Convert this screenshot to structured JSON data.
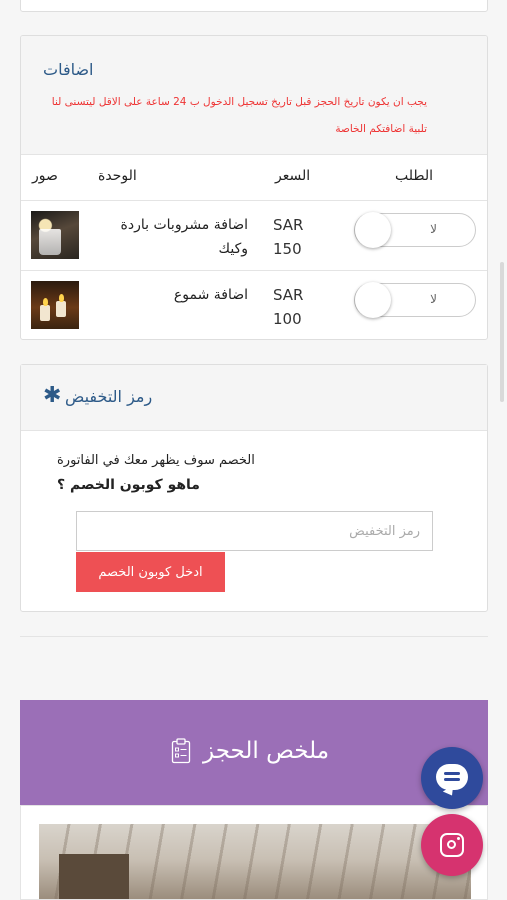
{
  "extras": {
    "title": "اضافات",
    "note": "يجب ان يكون تاريخ الحجز قبل تاريخ تسجيل الدخول ب 24 ساعة على الاقل ليتسنى لنا تلبية اضافتكم الخاصة",
    "columns": {
      "photos": "صور",
      "unit": "الوحدة",
      "price": "السعر",
      "order": "الطلب"
    },
    "items": [
      {
        "name": "اضافة مشروبات باردة وكيك",
        "currency": "SAR",
        "price": "150",
        "toggle_label": "لا"
      },
      {
        "name": "اضافة شموع",
        "currency": "SAR",
        "price": "100",
        "toggle_label": "لا"
      }
    ]
  },
  "discount": {
    "title": "رمز التخفيض",
    "description": "الخصم سوف يظهر معك في الفاتورة",
    "question": "ماهو كوبون الخصم ؟",
    "input_placeholder": "رمز التخفيض",
    "button_label": "ادخل كوبون الخصم"
  },
  "summary": {
    "title": "ملخص الحجز"
  },
  "colors": {
    "accent_purple": "#9b6fb7",
    "button_red": "#ee5054",
    "chat_blue": "#2f4a9c",
    "instagram_pink": "#d6336f"
  }
}
